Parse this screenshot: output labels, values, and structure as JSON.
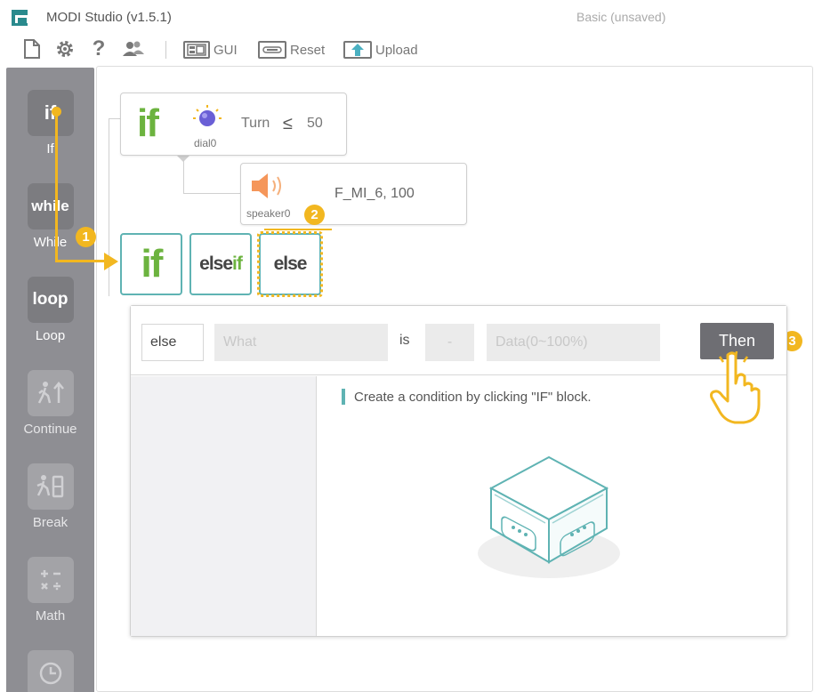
{
  "window": {
    "title": "MODI Studio (v1.5.1)",
    "file_status": "Basic (unsaved)"
  },
  "toolbar": {
    "help_glyph": "?",
    "gui_label": "GUI",
    "reset_label": "Reset",
    "upload_label": "Upload"
  },
  "sidebar": {
    "items": [
      {
        "tile": "if",
        "label": "If"
      },
      {
        "tile": "while",
        "label": "While"
      },
      {
        "tile": "loop",
        "label": "Loop"
      },
      {
        "tile": "",
        "label": "Continue"
      },
      {
        "tile": "",
        "label": "Break"
      },
      {
        "tile": "",
        "label": "Math"
      }
    ]
  },
  "canvas": {
    "if_block": {
      "keyword": "if",
      "module": "dial0",
      "property": "Turn",
      "operator": "≤",
      "value": "50"
    },
    "speaker_block": {
      "module": "speaker0",
      "value": "F_MI_6, 100"
    },
    "control_buttons": {
      "if": "if",
      "elseif_a": "else",
      "elseif_b": "if",
      "else": "else"
    },
    "badges": [
      "1",
      "2",
      "3"
    ]
  },
  "panel": {
    "keyword": "else",
    "what_placeholder": "What",
    "is_label": "is",
    "dash": "-",
    "data_placeholder": "Data(0~100%)",
    "then_label": "Then",
    "hint": "Create a condition by clicking \"IF\" block."
  },
  "colors": {
    "sidebar_bg": "#8e8e93",
    "accent_teal": "#5fb3b3",
    "if_green": "#6cb33f",
    "badge_yellow": "#f2b720",
    "then_bg": "#6e6e73"
  }
}
